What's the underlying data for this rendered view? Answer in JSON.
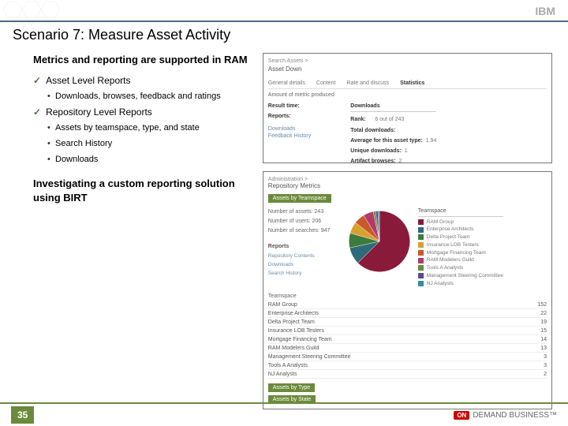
{
  "header": {
    "logo_text": "IBM"
  },
  "slide": {
    "title": "Scenario 7: Measure Asset Activity",
    "number": "35"
  },
  "left": {
    "h1": "Metrics and reporting are supported in RAM",
    "item1": "Asset Level Reports",
    "item1_sub1": "Downloads, browses, feedback and ratings",
    "item2": "Repository Level Reports",
    "item2_sub1": "Assets by teamspace, type, and state",
    "item2_sub2": "Search History",
    "item2_sub3": "Downloads",
    "h2": "Investigating a custom reporting solution using BIRT"
  },
  "ss1": {
    "breadcrumb": "Search Assets >",
    "title": "Asset Down",
    "tabs": [
      "General details",
      "Content",
      "Rate and discuss",
      "Statistics"
    ],
    "active_tab": 3,
    "left_labels": {
      "l1": "Result time:",
      "l2": "Reports:",
      "l3": "Downloads",
      "l4": "Feedback History"
    },
    "right": {
      "dl_head": "Downloads",
      "r1k": "Rank:",
      "r1v": "6 out of 243",
      "r2k": "Total downloads:",
      "r3k": "Average for this asset type:",
      "r3v": "1.94",
      "r4k": "Unique downloads:",
      "r4v": "1",
      "r5k": "Artifact browses:",
      "r5v": "2"
    }
  },
  "ss2": {
    "breadcrumb": "Administration >",
    "title": "Repository Metrics",
    "btn1": "Assets by Teamspace",
    "stats": {
      "s1": "Number of assets: 243",
      "s2": "Number of users: 206",
      "s3": "Number of searches: 947"
    },
    "reports_head": "Reports",
    "reports": [
      "Repository Contents",
      "Downloads",
      "Search History"
    ],
    "legend_head": "Teamspace",
    "legend": [
      {
        "label": "RAM Group",
        "color": "#8a1a3a"
      },
      {
        "label": "Enterprise Architects",
        "color": "#2e6a7a"
      },
      {
        "label": "Delta Project Team",
        "color": "#3d7a3d"
      },
      {
        "label": "Insurance LOB Testers",
        "color": "#d8a030"
      },
      {
        "label": "Mortgage Financing Team",
        "color": "#c85a2a"
      },
      {
        "label": "RAM Modelers Guild",
        "color": "#b03a6a"
      },
      {
        "label": "Tools A Analysts",
        "color": "#6a8a3a"
      },
      {
        "label": "Management Steering Committee",
        "color": "#5a4a8a"
      },
      {
        "label": "NJ Analysts",
        "color": "#3a8a9a"
      }
    ],
    "table_head": "Teamspace",
    "table": [
      {
        "name": "RAM Group",
        "val": "152"
      },
      {
        "name": "Enterprise Architects",
        "val": "22"
      },
      {
        "name": "Delta Project Team",
        "val": "19"
      },
      {
        "name": "Insurance LOB Testers",
        "val": "15"
      },
      {
        "name": "Mortgage Financing Team",
        "val": "14"
      },
      {
        "name": "RAM Modelers Guild",
        "val": "13"
      },
      {
        "name": "Management Steering Committee",
        "val": "3"
      },
      {
        "name": "Tools A Analysts",
        "val": "3"
      },
      {
        "name": "NJ Analysts",
        "val": "2"
      }
    ],
    "btn2": "Assets by Type",
    "btn3": "Assets by State"
  },
  "chart_data": {
    "type": "pie",
    "title": "Assets by Teamspace",
    "series": [
      {
        "name": "RAM Group",
        "value": 152,
        "color": "#8a1a3a"
      },
      {
        "name": "Enterprise Architects",
        "value": 22,
        "color": "#2e6a7a"
      },
      {
        "name": "Delta Project Team",
        "value": 19,
        "color": "#3d7a3d"
      },
      {
        "name": "Insurance LOB Testers",
        "value": 15,
        "color": "#d8a030"
      },
      {
        "name": "Mortgage Financing Team",
        "value": 14,
        "color": "#c85a2a"
      },
      {
        "name": "RAM Modelers Guild",
        "value": 13,
        "color": "#b03a6a"
      },
      {
        "name": "Tools A Analysts",
        "value": 3,
        "color": "#6a8a3a"
      },
      {
        "name": "Management Steering Committee",
        "value": 3,
        "color": "#5a4a8a"
      },
      {
        "name": "NJ Analysts",
        "value": 2,
        "color": "#3a8a9a"
      }
    ]
  },
  "footer": {
    "on": "ON",
    "demand": "DEMAND BUSINESS™"
  }
}
